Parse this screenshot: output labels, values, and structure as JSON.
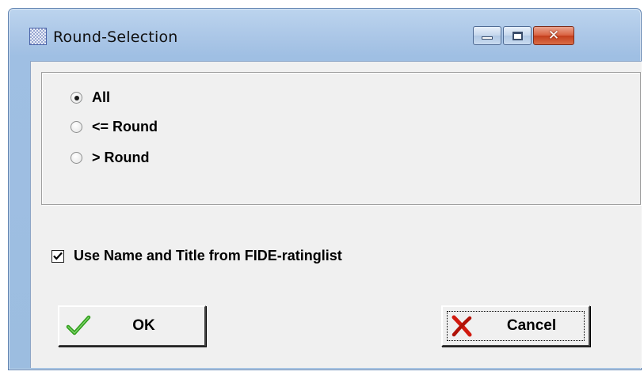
{
  "window": {
    "title": "Round-Selection",
    "controls": {
      "minimize_icon": "minimize-icon",
      "maximize_icon": "maximize-icon",
      "close_icon": "close-icon",
      "close_color": "#c9462a"
    }
  },
  "round_options": {
    "items": [
      {
        "label": "All",
        "selected": true
      },
      {
        "label": "<= Round",
        "selected": false
      },
      {
        "label": "> Round",
        "selected": false
      }
    ]
  },
  "use_fide": {
    "label": "Use Name and Title from FIDE-ratinglist",
    "checked": true
  },
  "buttons": {
    "ok_label": "OK",
    "ok_icon": "checkmark-icon",
    "cancel_label": "Cancel",
    "cancel_icon": "x-icon"
  },
  "colors": {
    "titlebar": "#a9c5e6",
    "client_bg": "#f0f0f0",
    "ok_green": "#2f9e1a",
    "cancel_red": "#d11a0f"
  }
}
